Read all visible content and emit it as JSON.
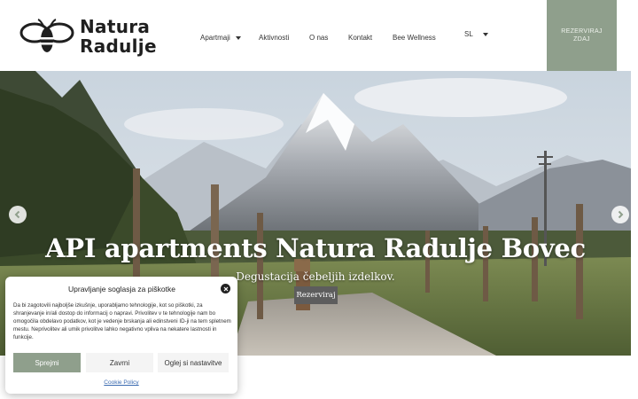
{
  "brand": {
    "line1": "Natura",
    "line2": "Radulje"
  },
  "nav": {
    "items": [
      {
        "label": "Apartmaji",
        "has_dropdown": true
      },
      {
        "label": "Aktivnosti",
        "has_dropdown": false
      },
      {
        "label": "O nas",
        "has_dropdown": false
      },
      {
        "label": "Kontakt",
        "has_dropdown": false
      },
      {
        "label": "Bee Wellness",
        "has_dropdown": false
      }
    ],
    "language": "SL",
    "cta_label": "REZERVIRAJ ZDAJ"
  },
  "hero": {
    "title": "API apartments Natura Radulje Bovec",
    "subtitle": "Degustacija čebeljih izdelkov.",
    "button_label": "Rezerviraj",
    "prev_icon": "chevron-left-icon",
    "next_icon": "chevron-right-icon"
  },
  "cookie": {
    "title": "Upravljanje soglasja za piškotke",
    "text": "Da bi zagotovili najboljše izkušnje, uporabljamo tehnologije, kot so piškotki, za shranjevanje in/ali dostop do informacij o napravi. Privolitev v te tehnologije nam bo omogočila obdelavo podatkov, kot je vedenje brskanja ali edinstveni ID-ji na tem spletnem mestu. Neprivolitev ali umik privolitve lahko negativno vpliva na nekatere lastnosti in funkcije.",
    "accept_label": "Sprejmi",
    "deny_label": "Zavrni",
    "prefs_label": "Oglej si nastavitve",
    "policy_label": "Cookie Policy"
  },
  "colors": {
    "accent": "#8f9f8c",
    "text": "#333333",
    "link": "#3a6ab0"
  }
}
